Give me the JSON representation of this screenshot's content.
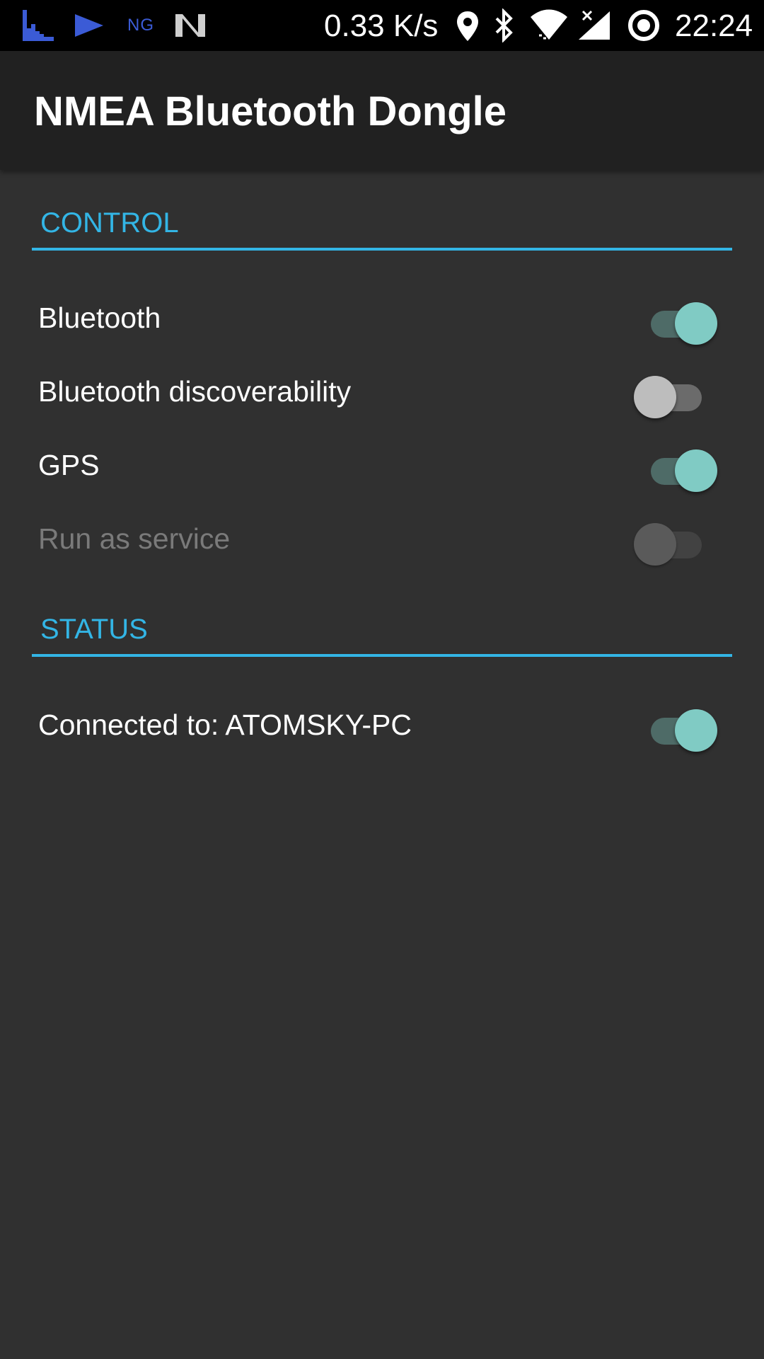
{
  "status_bar": {
    "notification_icons": [
      "graph-icon",
      "send-icon",
      "ng-icon",
      "n-logo-icon"
    ],
    "ng_text": "NG",
    "net_speed": "0.33 K/s",
    "system_icons": [
      "location-icon",
      "bluetooth-icon",
      "wifi-icon",
      "signal-icon",
      "sync-icon"
    ],
    "time": "22:24"
  },
  "app_bar": {
    "title": "NMEA Bluetooth Dongle"
  },
  "sections": {
    "control": {
      "title": "CONTROL",
      "items": [
        {
          "label": "Bluetooth",
          "checked": true,
          "enabled": true
        },
        {
          "label": "Bluetooth discoverability",
          "checked": false,
          "enabled": true
        },
        {
          "label": "GPS",
          "checked": true,
          "enabled": true
        },
        {
          "label": "Run as service",
          "checked": false,
          "enabled": false
        }
      ]
    },
    "status": {
      "title": "STATUS",
      "items": [
        {
          "label": "Connected to: ATOMSKY-PC",
          "checked": true,
          "enabled": true
        }
      ]
    }
  },
  "colors": {
    "accent": "#33b5e5",
    "switch_on": "#80cbc4",
    "background": "#303030",
    "app_bar": "#212121"
  }
}
